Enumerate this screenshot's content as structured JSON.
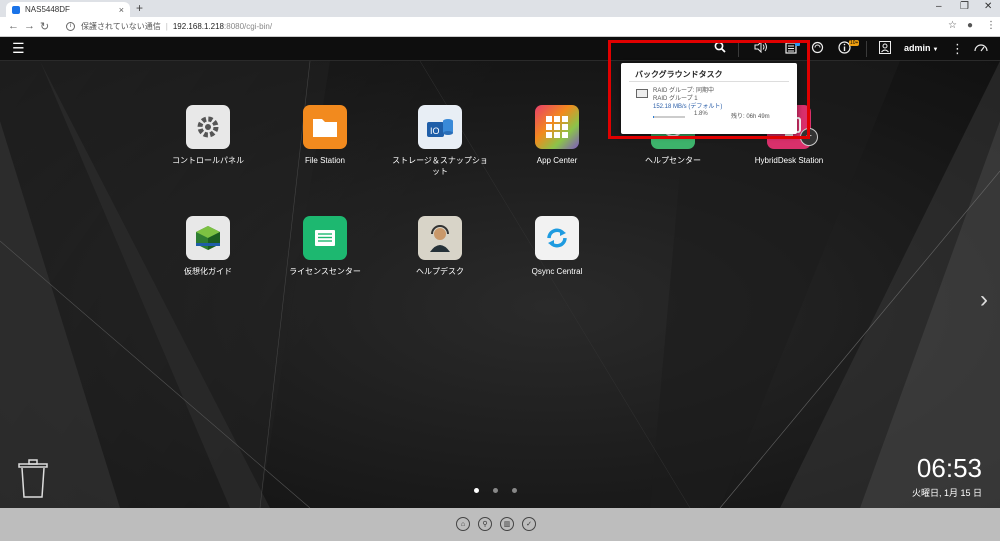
{
  "browser": {
    "tab_title": "NAS5448DF",
    "close_glyph": "×",
    "new_tab_glyph": "+",
    "security_label": "保護されていない通信",
    "url_host": "192.168.1.218",
    "url_path": ":8080/cgi-bin/"
  },
  "topbar": {
    "user": "admin",
    "icons": [
      "menu-icon",
      "search-icon",
      "volume-icon",
      "background-task-icon",
      "sync-icon",
      "info-icon",
      "user-icon",
      "more-icon",
      "dashboard-icon"
    ],
    "info_badge": "10+"
  },
  "apps": [
    {
      "label": "コントロールパネル",
      "icon": "gear-icon",
      "color": "#e8e8e8"
    },
    {
      "label": "File Station",
      "icon": "folder-icon",
      "color": "#f28a1e"
    },
    {
      "label": "ストレージ＆スナップショット",
      "icon": "storage-icon",
      "color": "#e8eef5"
    },
    {
      "label": "App Center",
      "icon": "app-grid-icon",
      "color": "#e83e6b"
    },
    {
      "label": "ヘルプセンター",
      "icon": "help-icon",
      "color": "#3db36b"
    },
    {
      "label": "HybridDesk Station",
      "icon": "hybriddesk-icon",
      "color": "#d9306b"
    },
    {
      "label": "仮想化ガイド",
      "icon": "virtualization-icon",
      "color": "#e8e8e8"
    },
    {
      "label": "ライセンスセンター",
      "icon": "license-icon",
      "color": "#1db870"
    },
    {
      "label": "ヘルプデスク",
      "icon": "helpdesk-icon",
      "color": "#d8d4c8"
    },
    {
      "label": "Qsync Central",
      "icon": "qsync-icon",
      "color": "#f2f2f2"
    }
  ],
  "popup": {
    "title": "バックグラウンドタスク",
    "line1": "RAID グループ: 同期中",
    "line2": "RAID グループ 1",
    "line3": "152.18 MB/s (デフォルト)",
    "percent": "1.8%",
    "progress": 0.018,
    "remaining": "残り: 06h 49m"
  },
  "clock": {
    "time": "06:53",
    "date": "火曜日, 1月 15 日"
  },
  "pagination": {
    "pages": 3,
    "active": 1
  },
  "dock": [
    "dock-home-icon",
    "dock-search-icon",
    "dock-grid-icon",
    "dock-check-icon"
  ],
  "colors": {
    "highlight": "#e00000",
    "accent": "#2c9bf0"
  }
}
